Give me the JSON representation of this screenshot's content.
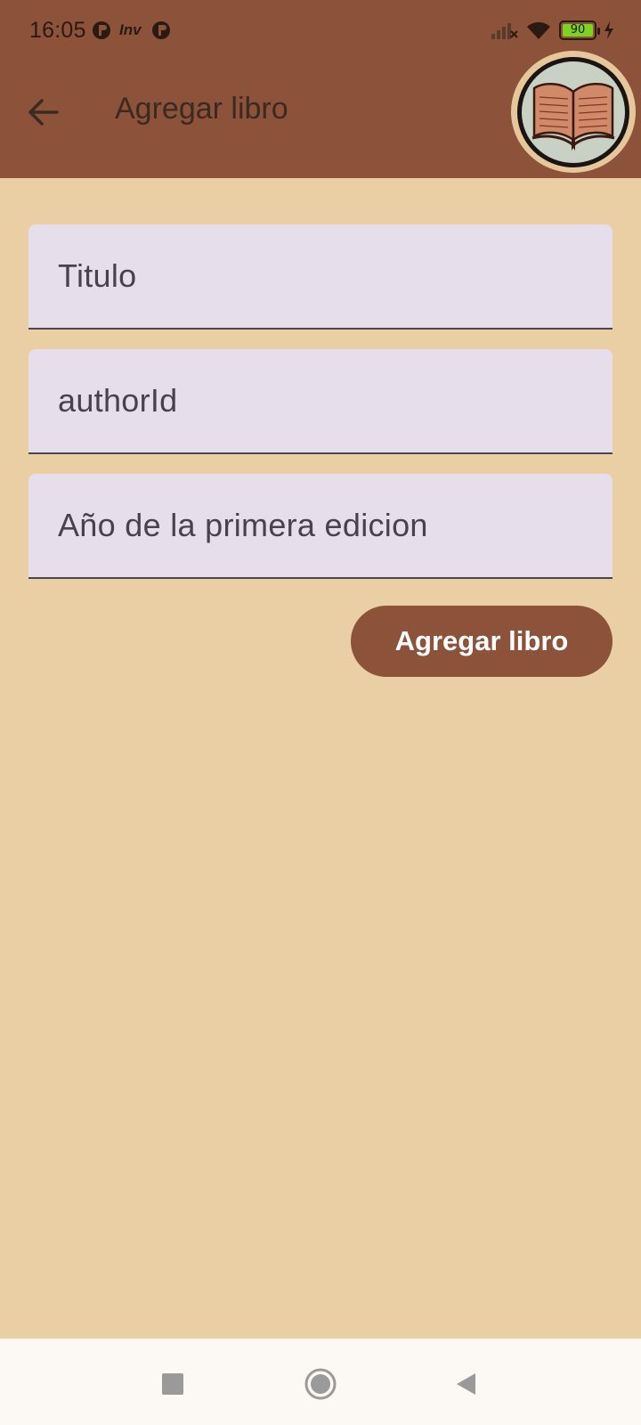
{
  "status_bar": {
    "time": "16:05",
    "app_label": "Inv",
    "battery": "90"
  },
  "app_bar": {
    "title": "Agregar libro"
  },
  "form": {
    "fields": [
      {
        "placeholder": "Titulo"
      },
      {
        "placeholder": "authorId"
      },
      {
        "placeholder": "Año de la primera edicion"
      }
    ],
    "submit_label": "Agregar libro"
  },
  "colors": {
    "primary": "#8C523A",
    "background": "#EACFA5",
    "field_fill": "#E6DEEB",
    "battery_fill": "#7ED321"
  },
  "icons": [
    "back-arrow-icon",
    "book-avatar-icon",
    "square-nav-icon",
    "home-circle-nav-icon",
    "triangle-back-nav-icon"
  ]
}
